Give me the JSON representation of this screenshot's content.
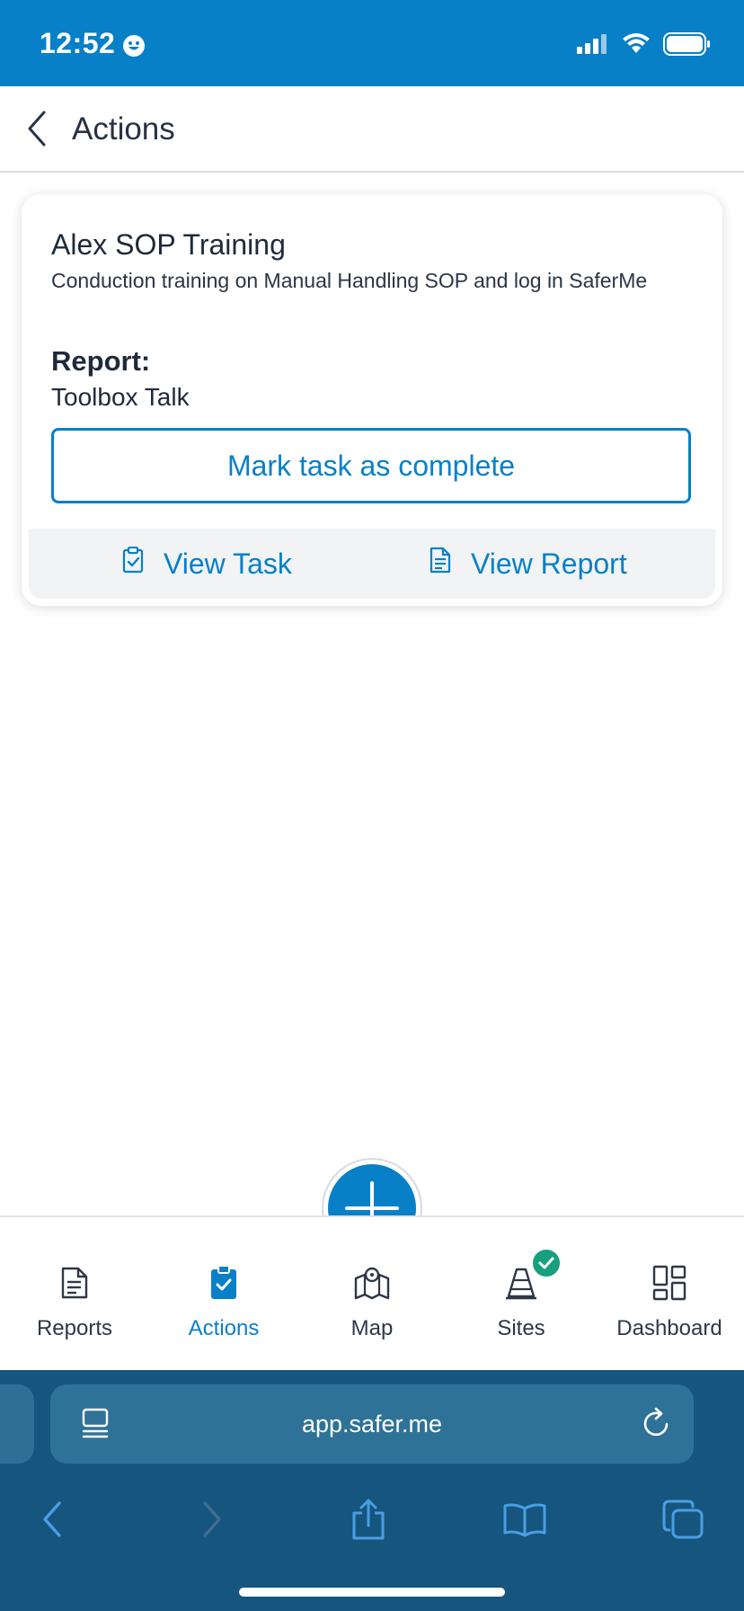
{
  "status_bar": {
    "time": "12:52"
  },
  "header": {
    "title": "Actions"
  },
  "card": {
    "title": "Alex SOP Training",
    "description": "Conduction training on Manual Handling SOP and log in SaferMe",
    "report_label": "Report:",
    "report_value": "Toolbox Talk",
    "complete_button": "Mark task as complete",
    "view_task": "View Task",
    "view_report": "View Report"
  },
  "bottom_nav": {
    "items": [
      {
        "label": "Reports",
        "icon": "reports-icon"
      },
      {
        "label": "Actions",
        "icon": "actions-icon",
        "active": true
      },
      {
        "label": "Map",
        "icon": "map-icon"
      },
      {
        "label": "Sites",
        "icon": "sites-icon"
      },
      {
        "label": "Dashboard",
        "icon": "dashboard-icon"
      }
    ]
  },
  "browser": {
    "url": "app.safer.me"
  },
  "colors": {
    "brand_blue": "#0780c8",
    "browser_bg": "#16557e",
    "sites_badge": "#17a07e"
  }
}
